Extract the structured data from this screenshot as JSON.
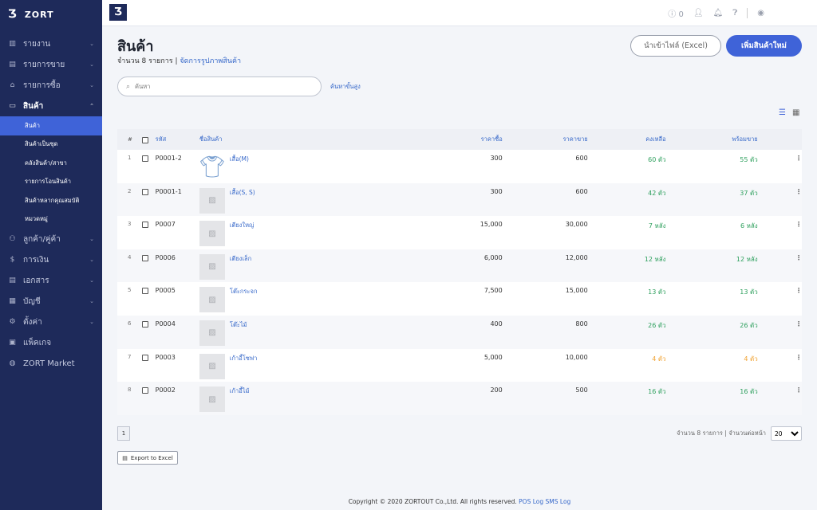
{
  "app": {
    "brand": "ZORT",
    "topbar_logo": "Ʒ",
    "notif_count": "0"
  },
  "sidebar": {
    "items": [
      {
        "label": "รายงาน",
        "icon": "chart-icon",
        "glyph": "▥",
        "chevron": "⌄"
      },
      {
        "label": "รายการขาย",
        "icon": "clipboard-icon",
        "glyph": "▤",
        "chevron": "⌄"
      },
      {
        "label": "รายการซื้อ",
        "icon": "basket-icon",
        "glyph": "⌂",
        "chevron": "⌄"
      },
      {
        "label": "สินค้า",
        "icon": "box-icon",
        "glyph": "▭",
        "chevron": "⌃"
      }
    ],
    "sub_items": [
      "สินค้า",
      "สินค้าเป็นชุด",
      "คลังสินค้า/สาขา",
      "รายการโอนสินค้า",
      "สินค้าหลากคุณสมบัติ",
      "หมวดหมู่"
    ],
    "items_after": [
      {
        "label": "ลูกค้า/คู่ค้า",
        "icon": "users-icon",
        "glyph": "⚇",
        "chevron": "⌄"
      },
      {
        "label": "การเงิน",
        "icon": "money-icon",
        "glyph": "$",
        "chevron": "⌄"
      },
      {
        "label": "เอกสาร",
        "icon": "document-icon",
        "glyph": "▤",
        "chevron": "⌄"
      },
      {
        "label": "บัญชี",
        "icon": "ledger-icon",
        "glyph": "▦",
        "chevron": "⌄"
      },
      {
        "label": "ตั้งค่า",
        "icon": "gear-icon",
        "glyph": "⚙",
        "chevron": "⌄"
      },
      {
        "label": "แพ็คเกจ",
        "icon": "package-icon",
        "glyph": "▣",
        "chevron": ""
      },
      {
        "label": "ZORT Market",
        "icon": "chat-icon",
        "glyph": "◍",
        "chevron": ""
      }
    ]
  },
  "page": {
    "title": "สินค้า",
    "count_text": "จำนวน 8 รายการ",
    "manage_images": "จัดการรูปภาพสินค้า",
    "import_label": "นำเข้าไฟล์ (Excel)",
    "add_label": "เพิ่มสินค้าใหม่",
    "search_placeholder": "ค้นหา",
    "advanced_search": "ค้นหาขั้นสูง"
  },
  "table": {
    "headers": {
      "num": "#",
      "code": "รหัส",
      "name": "ชื่อสินค้า",
      "cost": "ราคาซื้อ",
      "price": "ราคาขาย",
      "stock": "คงเหลือ",
      "available": "พร้อมขาย"
    },
    "rows": [
      {
        "num": "1",
        "code": "P0001-2",
        "name": "เสื้อ(M)",
        "cost": "300",
        "price": "600",
        "stock": "60 ตัว",
        "available": "55 ตัว",
        "status": "green",
        "image": "shirt"
      },
      {
        "num": "2",
        "code": "P0001-1",
        "name": "เสื้อ(S, S)",
        "cost": "300",
        "price": "600",
        "stock": "42 ตัว",
        "available": "37 ตัว",
        "status": "green",
        "image": "placeholder"
      },
      {
        "num": "3",
        "code": "P0007",
        "name": "เตียงใหญ่",
        "cost": "15,000",
        "price": "30,000",
        "stock": "7 หลัง",
        "available": "6 หลัง",
        "status": "green",
        "image": "placeholder"
      },
      {
        "num": "4",
        "code": "P0006",
        "name": "เตียงเล็ก",
        "cost": "6,000",
        "price": "12,000",
        "stock": "12 หลัง",
        "available": "12 หลัง",
        "status": "green",
        "image": "placeholder"
      },
      {
        "num": "5",
        "code": "P0005",
        "name": "โต๊ะกระจก",
        "cost": "7,500",
        "price": "15,000",
        "stock": "13 ตัว",
        "available": "13 ตัว",
        "status": "green",
        "image": "placeholder"
      },
      {
        "num": "6",
        "code": "P0004",
        "name": "โต๊ะไม้",
        "cost": "400",
        "price": "800",
        "stock": "26 ตัว",
        "available": "26 ตัว",
        "status": "green",
        "image": "placeholder"
      },
      {
        "num": "7",
        "code": "P0003",
        "name": "เก้าอี้โซฟา",
        "cost": "5,000",
        "price": "10,000",
        "stock": "4 ตัว",
        "available": "4 ตัว",
        "status": "orange",
        "image": "placeholder"
      },
      {
        "num": "8",
        "code": "P0002",
        "name": "เก้าอี้ไม้",
        "cost": "200",
        "price": "500",
        "stock": "16 ตัว",
        "available": "16 ตัว",
        "status": "green",
        "image": "placeholder"
      }
    ]
  },
  "pagination": {
    "page": "1",
    "summary": "จำนวน 8 รายการ | จำนวนต่อหน้า",
    "per_page": "20"
  },
  "export_label": "Export to Excel",
  "footer": {
    "copyright": "Copyright © 2020 ZORTOUT Co.,Ltd. All rights reserved.",
    "pos": "POS",
    "log": "Log",
    "sms_log": "SMS Log"
  },
  "colors": {
    "sidebar": "#1e2a5a",
    "accent": "#3f63d8",
    "ok": "#2fa05e",
    "warn": "#f0a232"
  }
}
